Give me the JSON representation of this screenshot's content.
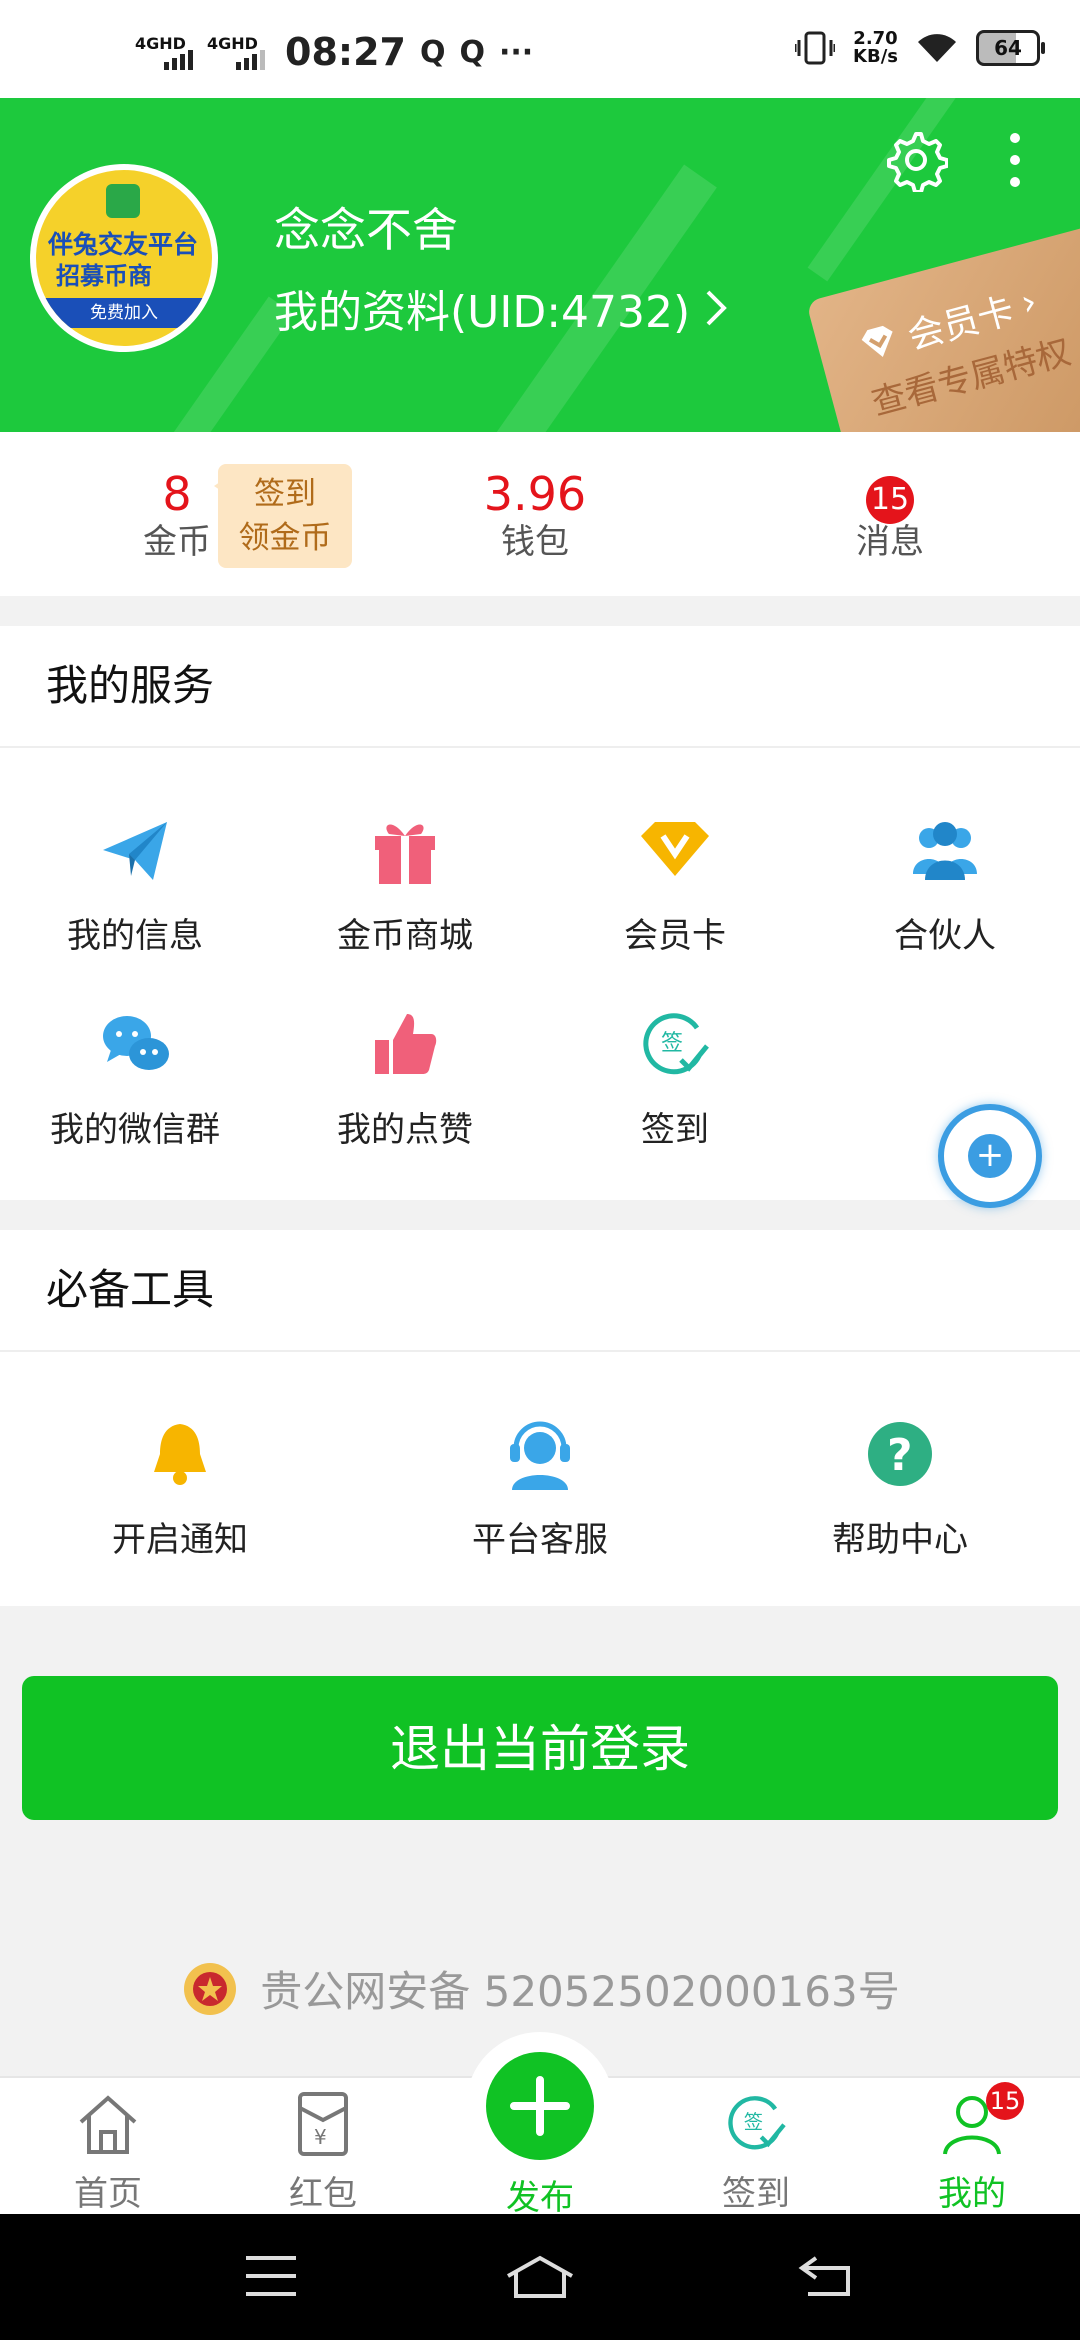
{
  "status_bar": {
    "net1": "4GHD",
    "net2": "4GHD",
    "time": "08:27",
    "dots": "···",
    "speed_value": "2.70",
    "speed_unit": "KB/s",
    "battery": "64"
  },
  "header": {
    "username": "念念不舍",
    "profile_link": "我的资料(UID:4732)",
    "avatar_text1": "伴兔交友平台",
    "avatar_text2": "招募币商",
    "avatar_band": "免费加入",
    "vip_title": "会员卡",
    "vip_sub": "查看专属特权"
  },
  "stats": {
    "coins_value": "8",
    "coins_label": "金币",
    "checkin_line1": "签到",
    "checkin_line2": "领金币",
    "wallet_value": "3.96",
    "wallet_label": "钱包",
    "messages_badge": "15",
    "messages_label": "消息"
  },
  "services": {
    "title": "我的服务",
    "items": [
      {
        "label": "我的信息",
        "icon": "paper-plane-icon"
      },
      {
        "label": "金币商城",
        "icon": "gift-icon"
      },
      {
        "label": "会员卡",
        "icon": "diamond-v-icon"
      },
      {
        "label": "合伙人",
        "icon": "partners-icon"
      },
      {
        "label": "我的微信群",
        "icon": "wechat-icon"
      },
      {
        "label": "我的点赞",
        "icon": "thumbs-up-icon"
      },
      {
        "label": "签到",
        "icon": "checkin-icon"
      }
    ]
  },
  "tools": {
    "title": "必备工具",
    "items": [
      {
        "label": "开启通知",
        "icon": "bell-icon"
      },
      {
        "label": "平台客服",
        "icon": "headset-icon"
      },
      {
        "label": "帮助中心",
        "icon": "help-icon"
      }
    ]
  },
  "logout_label": "退出当前登录",
  "icp": "贵公网安备 52052502000163号",
  "bottom_nav": {
    "items": [
      {
        "label": "首页",
        "icon": "home-icon"
      },
      {
        "label": "红包",
        "icon": "red-packet-icon"
      },
      {
        "label": "发布",
        "icon": "plus-icon"
      },
      {
        "label": "签到",
        "icon": "checkin-icon"
      },
      {
        "label": "我的",
        "icon": "user-icon"
      }
    ],
    "active": "我的",
    "mine_badge": "15"
  },
  "colors": {
    "brand_green": "#1dc93d",
    "accent_red": "#e4141b",
    "button_green": "#10c224"
  }
}
